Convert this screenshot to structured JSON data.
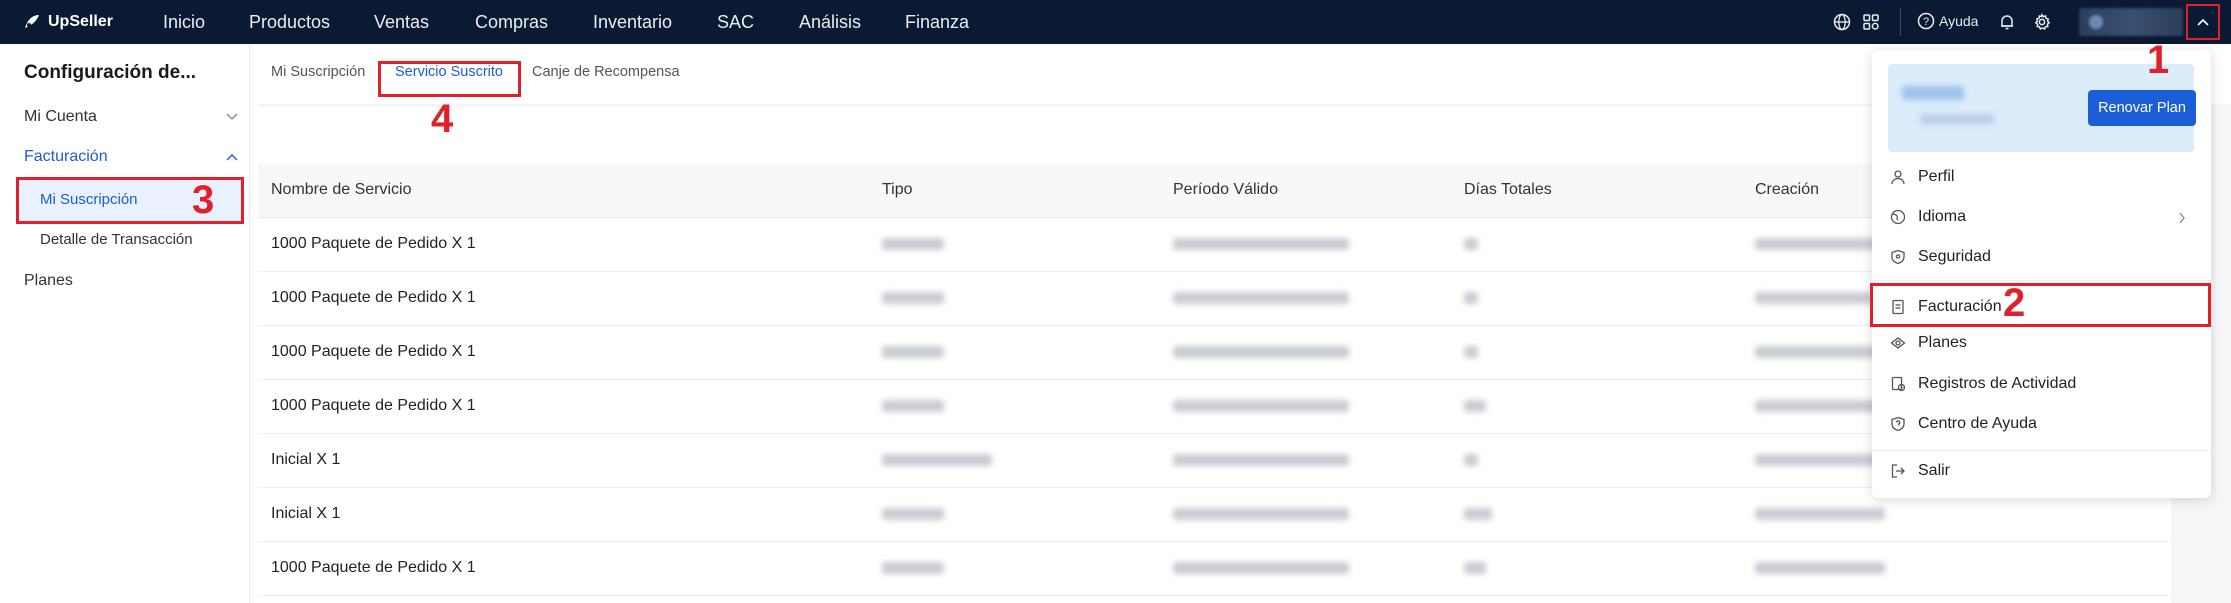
{
  "app": {
    "name": "UpSeller"
  },
  "nav": [
    "Inicio",
    "Productos",
    "Ventas",
    "Compras",
    "Inventario",
    "SAC",
    "Análisis",
    "Finanza"
  ],
  "topbar": {
    "help_label": "Ayuda"
  },
  "sidebar": {
    "title": "Configuración de...",
    "items": [
      {
        "label": "Mi Cuenta"
      },
      {
        "label": "Facturación"
      },
      {
        "label": "Mi Suscripción"
      },
      {
        "label": "Detalle de Transacción"
      },
      {
        "label": "Planes"
      }
    ]
  },
  "tabs": [
    "Mi Suscripción",
    "Servicio Suscrito",
    "Canje de Recompensa"
  ],
  "table": {
    "columns": [
      "Nombre de Servicio",
      "Tipo",
      "Período Válido",
      "Días Totales",
      "Creación"
    ],
    "rows": [
      "1000 Paquete de Pedido X 1",
      "1000 Paquete de Pedido X 1",
      "1000 Paquete de Pedido X 1",
      "1000 Paquete de Pedido X 1",
      "Inicial X 1",
      "Inicial X 1",
      "1000 Paquete de Pedido X 1"
    ]
  },
  "dropdown": {
    "renew_label": "Renovar Plan",
    "items": [
      {
        "label": "Perfil",
        "icon": "user-icon"
      },
      {
        "label": "Idioma",
        "icon": "globe-icon"
      },
      {
        "label": "Seguridad",
        "icon": "shield-icon"
      },
      {
        "label": "Facturación",
        "icon": "document-icon"
      },
      {
        "label": "Planes",
        "icon": "plans-icon"
      },
      {
        "label": "Registros de Actividad",
        "icon": "log-icon"
      },
      {
        "label": "Centro de Ayuda",
        "icon": "help-shield-icon"
      },
      {
        "label": "Salir",
        "icon": "logout-icon"
      }
    ]
  },
  "annotations": [
    "1",
    "2",
    "3",
    "4"
  ],
  "colors": {
    "topbar": "#0a1a33",
    "accent": "#1b5ed6",
    "annotation": "#e0202a"
  }
}
